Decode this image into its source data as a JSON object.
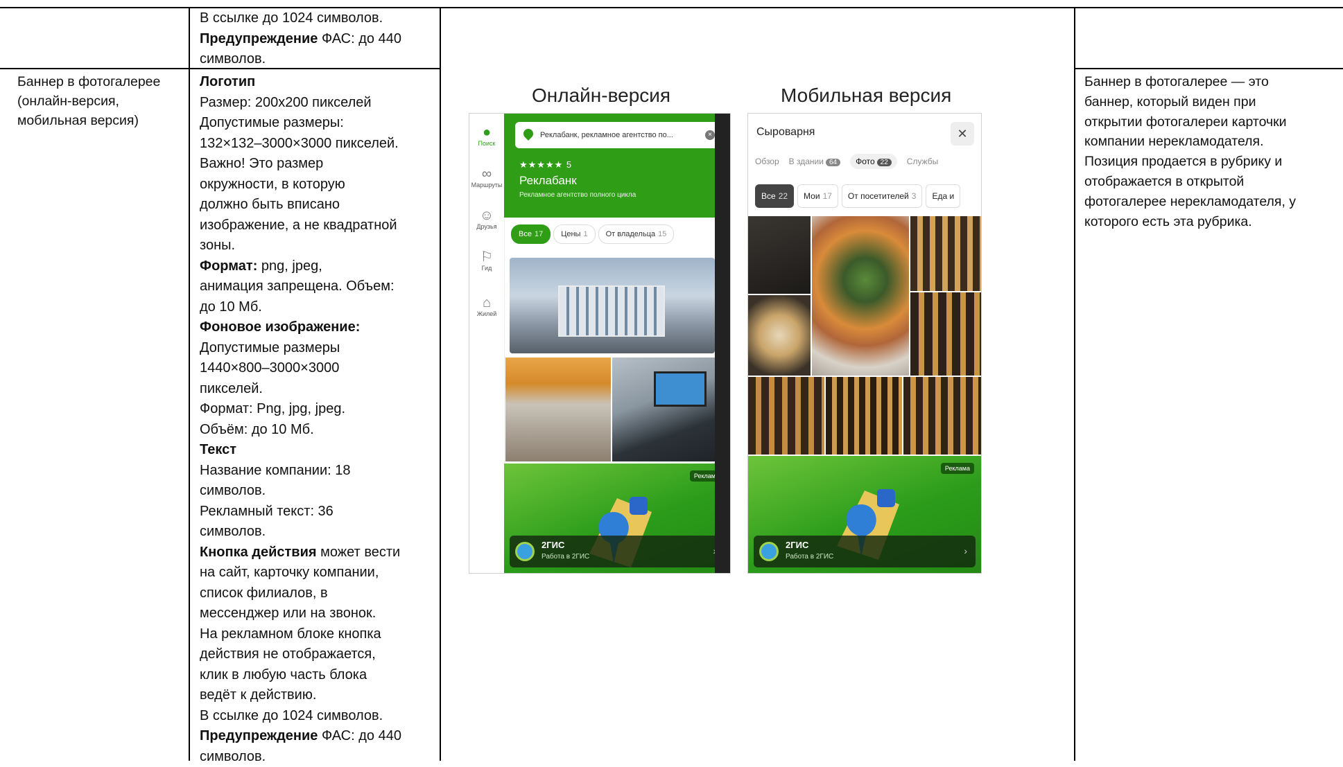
{
  "top_row": {
    "spec_lines": [
      [
        {
          "t": "В ссылке до 1024 символов.",
          "b": false
        }
      ],
      [
        {
          "t": "Предупреждение",
          "b": true
        },
        {
          "t": " ФАС: до 440",
          "b": false
        }
      ],
      [
        {
          "t": "символов.",
          "b": false
        }
      ]
    ]
  },
  "banner_row": {
    "name_lines": [
      "Баннер в фотогалерее",
      "(онлайн-версия,",
      "мобильная версия)"
    ],
    "spec_lines": [
      [
        {
          "t": "Логотип",
          "b": true
        }
      ],
      [
        {
          "t": "Размер: 200х200 пикселей",
          "b": false
        }
      ],
      [
        {
          "t": "Допустимые размеры:",
          "b": false
        }
      ],
      [
        {
          "t": "132×132–3000×3000 пикселей.",
          "b": false
        }
      ],
      [
        {
          "t": "Важно! Это размер",
          "b": false
        }
      ],
      [
        {
          "t": "окружности, в которую",
          "b": false
        }
      ],
      [
        {
          "t": "должно быть вписано",
          "b": false
        }
      ],
      [
        {
          "t": "изображение, а не квадратной",
          "b": false
        }
      ],
      [
        {
          "t": "зоны.",
          "b": false
        }
      ],
      [
        {
          "t": "Формат:",
          "b": true
        },
        {
          "t": " png, jpeg,",
          "b": false
        }
      ],
      [
        {
          "t": "анимация запрещена. Объем:",
          "b": false
        }
      ],
      [
        {
          "t": "до 10 Мб.",
          "b": false
        }
      ],
      [
        {
          "t": "Фоновое изображение:",
          "b": true
        }
      ],
      [
        {
          "t": "Допустимые размеры",
          "b": false
        }
      ],
      [
        {
          "t": "1440×800–3000×3000",
          "b": false
        }
      ],
      [
        {
          "t": "пикселей.",
          "b": false
        }
      ],
      [
        {
          "t": "Формат: Png, jpg, jpeg.",
          "b": false
        }
      ],
      [
        {
          "t": "Объём: до 10 Мб.",
          "b": false
        }
      ],
      [
        {
          "t": "Текст",
          "b": true
        }
      ],
      [
        {
          "t": "Название компании: 18",
          "b": false
        }
      ],
      [
        {
          "t": "символов.",
          "b": false
        }
      ],
      [
        {
          "t": "Рекламный текст: 36",
          "b": false
        }
      ],
      [
        {
          "t": "символов.",
          "b": false
        }
      ],
      [
        {
          "t": "Кнопка действия",
          "b": true
        },
        {
          "t": " может вести",
          "b": false
        }
      ],
      [
        {
          "t": "на сайт, карточку компании,",
          "b": false
        }
      ],
      [
        {
          "t": "список филиалов, в",
          "b": false
        }
      ],
      [
        {
          "t": "мессенджер или на звонок.",
          "b": false
        }
      ],
      [
        {
          "t": "На рекламном блоке кнопка",
          "b": false
        }
      ],
      [
        {
          "t": "действия не отображается,",
          "b": false
        }
      ],
      [
        {
          "t": "клик в любую часть блока",
          "b": false
        }
      ],
      [
        {
          "t": "ведёт к действию.",
          "b": false
        }
      ],
      [
        {
          "t": "В ссылке до 1024 символов.",
          "b": false
        }
      ],
      [
        {
          "t": "Предупреждение",
          "b": true
        },
        {
          "t": " ФАС: до 440",
          "b": false
        }
      ],
      [
        {
          "t": "символов.",
          "b": false
        }
      ]
    ],
    "description_lines": [
      "Баннер в фотогалерее — это",
      "баннер, который виден при",
      "открытии фотогалереи карточки",
      "компании нерекламодателя.",
      "Позиция продается в рубрику и",
      "отображается в открытой",
      "фотогалерее нерекламодателя, у",
      "которого есть эта рубрика."
    ]
  },
  "mockup": {
    "online_title": "Онлайн-версия",
    "mobile_title": "Мобильная версия",
    "online": {
      "sidebar": [
        "Поиск",
        "Маршруты",
        "Друзья",
        "Гид",
        "Жилей"
      ],
      "search_text": "Реклабанк, рекламное агентство по...",
      "stars": "★★★★★ 5",
      "org_name": "Реклабанк",
      "org_desc": "Рекламное агентство полного цикла",
      "chips": [
        {
          "label": "Все",
          "count": "17"
        },
        {
          "label": "Цены",
          "count": "1"
        },
        {
          "label": "От владельца",
          "count": "15"
        }
      ]
    },
    "mobile": {
      "title": "Сыроварня",
      "close": "✕",
      "tabs": [
        {
          "label": "Обзор",
          "count": ""
        },
        {
          "label": "В здании",
          "count": "64"
        },
        {
          "label": "Фото",
          "count": "22"
        },
        {
          "label": "Службы",
          "count": ""
        }
      ],
      "filters": [
        {
          "label": "Все",
          "count": "22"
        },
        {
          "label": "Мои",
          "count": "17"
        },
        {
          "label": "От посетителей",
          "count": "3"
        },
        {
          "label": "Еда и",
          "count": ""
        }
      ]
    },
    "ad": {
      "badge": "Реклама",
      "name": "2ГИС",
      "sub": "Работа в 2ГИС",
      "chevron": "›"
    }
  }
}
